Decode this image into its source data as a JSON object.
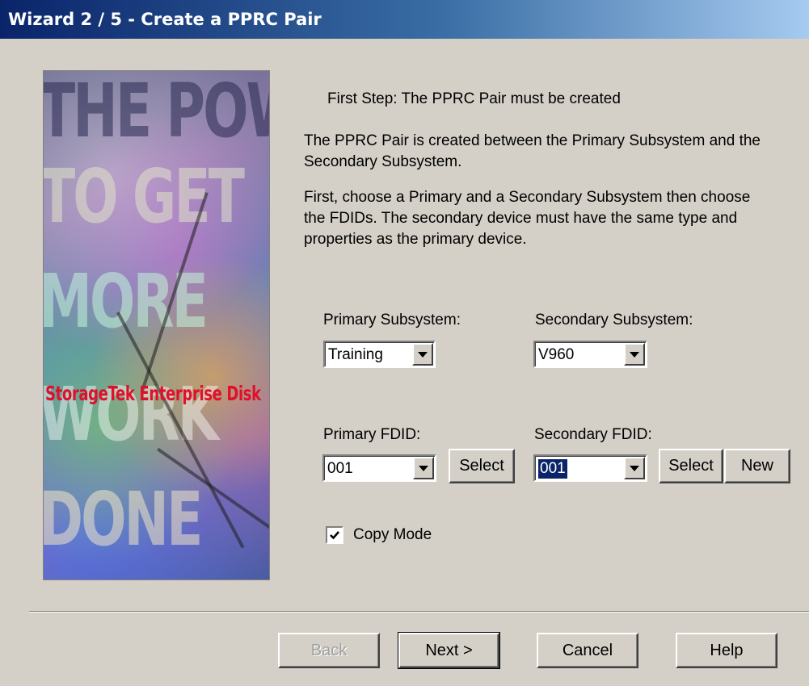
{
  "window": {
    "title": "Wizard 2 / 5 - Create a PPRC Pair"
  },
  "banner": {
    "line1": "THE POWER",
    "line2": "TO GET",
    "line3": "MORE",
    "line4": "WORK",
    "line5": "DONE",
    "tagline": "StorageTek Enterprise Disk"
  },
  "content": {
    "step_title": "First Step: The PPRC Pair must be created",
    "paragraph1": "The PPRC Pair is created between the Primary Subsystem and the Secondary Subsystem.",
    "paragraph2": "First, choose a Primary and a Secondary Subsystem then choose the FDIDs. The secondary device must have the same type and properties as the primary device."
  },
  "form": {
    "primary_subsystem_label": "Primary Subsystem:",
    "primary_subsystem_value": "Training",
    "secondary_subsystem_label": "Secondary Subsystem:",
    "secondary_subsystem_value": "V960",
    "primary_fdid_label": "Primary FDID:",
    "primary_fdid_value": "001",
    "secondary_fdid_label": "Secondary FDID:",
    "secondary_fdid_value": "001",
    "select_label": "Select",
    "new_label": "New",
    "copy_mode_label": "Copy Mode",
    "copy_mode_checked": true
  },
  "footer": {
    "back_label": "Back",
    "next_label": "Next >",
    "cancel_label": "Cancel",
    "help_label": "Help"
  },
  "icons": {
    "dropdown": "chevron-down-icon",
    "checkbox": "checkmark-icon"
  },
  "colors": {
    "title_gradient_start": "#0a246a",
    "title_gradient_end": "#a6caf0",
    "dialog_background": "#d4d0c8",
    "selection": "#0a246a",
    "banner_tagline": "#e0102a"
  }
}
